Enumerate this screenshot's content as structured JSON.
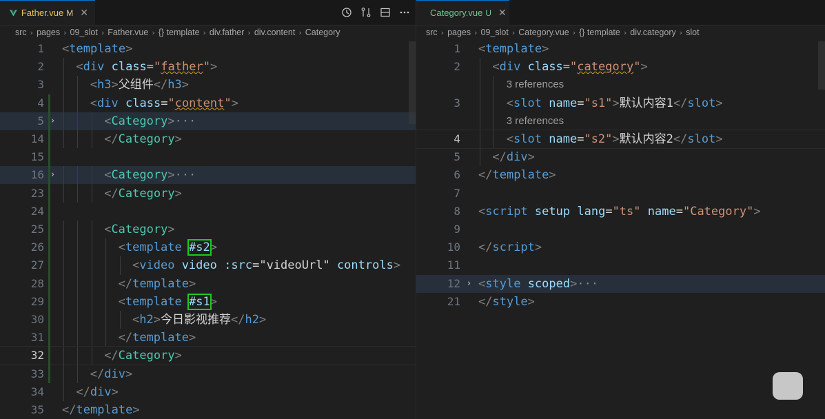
{
  "left": {
    "tab": {
      "name": "Father.vue",
      "status": "M",
      "close": "✕"
    },
    "breadcrumb": [
      "src",
      "pages",
      "09_slot",
      "Father.vue",
      "{} template",
      "div.father",
      "div.content",
      "Category"
    ],
    "lines": [
      {
        "n": "1",
        "parts": [
          [
            "brk",
            "<"
          ],
          [
            "tag",
            "template"
          ],
          [
            "brk",
            ">"
          ]
        ],
        "indent": 0
      },
      {
        "n": "2",
        "parts": [
          [
            "brk",
            "<"
          ],
          [
            "tag",
            "div"
          ],
          [
            "txt",
            " "
          ],
          [
            "attr",
            "class"
          ],
          [
            "txt",
            "="
          ],
          [
            "str",
            "\""
          ],
          [
            "str squig",
            "father"
          ],
          [
            "str",
            "\""
          ],
          [
            "brk",
            ">"
          ]
        ],
        "indent": 1
      },
      {
        "n": "3",
        "parts": [
          [
            "brk",
            "<"
          ],
          [
            "tag",
            "h3"
          ],
          [
            "brk",
            ">"
          ],
          [
            "txt",
            "父组件"
          ],
          [
            "brk",
            "</"
          ],
          [
            "tag",
            "h3"
          ],
          [
            "brk",
            ">"
          ]
        ],
        "indent": 2
      },
      {
        "n": "4",
        "parts": [
          [
            "brk",
            "<"
          ],
          [
            "tag",
            "div"
          ],
          [
            "txt",
            " "
          ],
          [
            "attr",
            "class"
          ],
          [
            "txt",
            "="
          ],
          [
            "str",
            "\""
          ],
          [
            "str squig",
            "content"
          ],
          [
            "str",
            "\""
          ],
          [
            "brk",
            ">"
          ]
        ],
        "indent": 2
      },
      {
        "n": "5",
        "parts": [
          [
            "brk",
            "<"
          ],
          [
            "comp",
            "Category"
          ],
          [
            "brk",
            ">"
          ],
          [
            "dim",
            "···"
          ]
        ],
        "indent": 3,
        "fold": true,
        "hl": true
      },
      {
        "n": "14",
        "parts": [
          [
            "brk",
            "</"
          ],
          [
            "comp",
            "Category"
          ],
          [
            "brk",
            ">"
          ]
        ],
        "indent": 3
      },
      {
        "n": "15",
        "parts": [],
        "indent": 0
      },
      {
        "n": "16",
        "parts": [
          [
            "brk",
            "<"
          ],
          [
            "comp",
            "Category"
          ],
          [
            "brk",
            ">"
          ],
          [
            "dim",
            "···"
          ]
        ],
        "indent": 3,
        "fold": true,
        "hl": true
      },
      {
        "n": "23",
        "parts": [
          [
            "brk",
            "</"
          ],
          [
            "comp",
            "Category"
          ],
          [
            "brk",
            ">"
          ]
        ],
        "indent": 3
      },
      {
        "n": "24",
        "parts": [],
        "indent": 0
      },
      {
        "n": "25",
        "parts": [
          [
            "brk",
            "<"
          ],
          [
            "comp",
            "Category"
          ],
          [
            "brk",
            ">"
          ]
        ],
        "indent": 3
      },
      {
        "n": "26",
        "parts": [
          [
            "brk",
            "<"
          ],
          [
            "tag",
            "template"
          ],
          [
            "txt",
            " "
          ],
          [
            "attr boxed",
            "#s2"
          ],
          [
            "brk",
            ">"
          ]
        ],
        "indent": 4
      },
      {
        "n": "27",
        "parts": [
          [
            "brk",
            "<"
          ],
          [
            "tag",
            "video"
          ],
          [
            "txt",
            " "
          ],
          [
            "attr",
            "video"
          ],
          [
            "txt",
            " "
          ],
          [
            "attr",
            ":src"
          ],
          [
            "txt",
            "="
          ],
          [
            "txt",
            "\"videoUrl\""
          ],
          [
            "txt",
            " "
          ],
          [
            "attr",
            "controls"
          ],
          [
            "brk",
            ">"
          ]
        ],
        "indent": 5
      },
      {
        "n": "28",
        "parts": [
          [
            "brk",
            "</"
          ],
          [
            "tag",
            "template"
          ],
          [
            "brk",
            ">"
          ]
        ],
        "indent": 4
      },
      {
        "n": "29",
        "parts": [
          [
            "brk",
            "<"
          ],
          [
            "tag",
            "template"
          ],
          [
            "txt",
            " "
          ],
          [
            "attr boxed",
            "#s1"
          ],
          [
            "brk",
            ">"
          ]
        ],
        "indent": 4
      },
      {
        "n": "30",
        "parts": [
          [
            "brk",
            "<"
          ],
          [
            "tag",
            "h2"
          ],
          [
            "brk",
            ">"
          ],
          [
            "txt",
            "今日影视推荐"
          ],
          [
            "brk",
            "</"
          ],
          [
            "tag",
            "h2"
          ],
          [
            "brk",
            ">"
          ]
        ],
        "indent": 5
      },
      {
        "n": "31",
        "parts": [
          [
            "brk",
            "</"
          ],
          [
            "tag",
            "template"
          ],
          [
            "brk",
            ">"
          ]
        ],
        "indent": 4
      },
      {
        "n": "32",
        "parts": [
          [
            "brk",
            "</"
          ],
          [
            "comp",
            "Category"
          ],
          [
            "brk",
            ">"
          ]
        ],
        "indent": 3,
        "active": true
      },
      {
        "n": "33",
        "parts": [
          [
            "brk",
            "</"
          ],
          [
            "tag",
            "div"
          ],
          [
            "brk",
            ">"
          ]
        ],
        "indent": 2
      },
      {
        "n": "34",
        "parts": [
          [
            "brk",
            "</"
          ],
          [
            "tag",
            "div"
          ],
          [
            "brk",
            ">"
          ]
        ],
        "indent": 1
      },
      {
        "n": "35",
        "parts": [
          [
            "brk",
            "</"
          ],
          [
            "tag",
            "template"
          ],
          [
            "brk",
            ">"
          ]
        ],
        "indent": 0
      }
    ]
  },
  "right": {
    "tab": {
      "name": "Category.vue",
      "status": "U",
      "close": "✕"
    },
    "breadcrumb": [
      "src",
      "pages",
      "09_slot",
      "Category.vue",
      "{} template",
      "div.category",
      "slot"
    ],
    "lines": [
      {
        "n": "1",
        "parts": [
          [
            "brk",
            "<"
          ],
          [
            "tag",
            "template"
          ],
          [
            "brk",
            ">"
          ]
        ],
        "indent": 0
      },
      {
        "n": "2",
        "parts": [
          [
            "brk",
            "<"
          ],
          [
            "tag",
            "div"
          ],
          [
            "txt",
            " "
          ],
          [
            "attr",
            "class"
          ],
          [
            "txt",
            "="
          ],
          [
            "str",
            "\""
          ],
          [
            "str squig",
            "category"
          ],
          [
            "str",
            "\""
          ],
          [
            "brk",
            ">"
          ]
        ],
        "indent": 1
      },
      {
        "ref": "3 references",
        "indent": 2
      },
      {
        "n": "3",
        "parts": [
          [
            "brk",
            "<"
          ],
          [
            "tag",
            "slot"
          ],
          [
            "txt",
            " "
          ],
          [
            "attr",
            "name"
          ],
          [
            "txt",
            "="
          ],
          [
            "str",
            "\"s1\""
          ],
          [
            "brk",
            ">"
          ],
          [
            "txt",
            "默认内容1"
          ],
          [
            "brk",
            "</"
          ],
          [
            "tag",
            "slot"
          ],
          [
            "brk",
            ">"
          ]
        ],
        "indent": 2
      },
      {
        "ref": "3 references",
        "indent": 2
      },
      {
        "n": "4",
        "parts": [
          [
            "brk",
            "<"
          ],
          [
            "tag",
            "slot"
          ],
          [
            "txt",
            " "
          ],
          [
            "attr",
            "name"
          ],
          [
            "txt",
            "="
          ],
          [
            "str",
            "\"s2\""
          ],
          [
            "brk",
            ">"
          ],
          [
            "txt",
            "默认内容2"
          ],
          [
            "brk",
            "</"
          ],
          [
            "tag",
            "slot"
          ],
          [
            "brk",
            ">"
          ]
        ],
        "indent": 2,
        "active": true
      },
      {
        "n": "5",
        "parts": [
          [
            "brk",
            "</"
          ],
          [
            "tag",
            "div"
          ],
          [
            "brk",
            ">"
          ]
        ],
        "indent": 1
      },
      {
        "n": "6",
        "parts": [
          [
            "brk",
            "</"
          ],
          [
            "tag",
            "template"
          ],
          [
            "brk",
            ">"
          ]
        ],
        "indent": 0
      },
      {
        "n": "7",
        "parts": [],
        "indent": 0
      },
      {
        "n": "8",
        "parts": [
          [
            "brk",
            "<"
          ],
          [
            "tag",
            "script"
          ],
          [
            "txt",
            " "
          ],
          [
            "attr",
            "setup"
          ],
          [
            "txt",
            " "
          ],
          [
            "attr",
            "lang"
          ],
          [
            "txt",
            "="
          ],
          [
            "str",
            "\"ts\""
          ],
          [
            "txt",
            " "
          ],
          [
            "attr",
            "name"
          ],
          [
            "txt",
            "="
          ],
          [
            "str",
            "\"Category\""
          ],
          [
            "brk",
            ">"
          ]
        ],
        "indent": 0
      },
      {
        "n": "9",
        "parts": [],
        "indent": 0
      },
      {
        "n": "10",
        "parts": [
          [
            "brk",
            "</"
          ],
          [
            "tag",
            "script"
          ],
          [
            "brk",
            ">"
          ]
        ],
        "indent": 0
      },
      {
        "n": "11",
        "parts": [],
        "indent": 0
      },
      {
        "n": "12",
        "parts": [
          [
            "brk",
            "<"
          ],
          [
            "tag",
            "style"
          ],
          [
            "txt",
            " "
          ],
          [
            "attr",
            "scoped"
          ],
          [
            "brk",
            ">"
          ],
          [
            "dim",
            "···"
          ]
        ],
        "indent": 0,
        "fold": true,
        "hl": true
      },
      {
        "n": "21",
        "parts": [
          [
            "brk",
            "</"
          ],
          [
            "tag",
            "style"
          ],
          [
            "brk",
            ">"
          ]
        ],
        "indent": 0
      }
    ]
  },
  "icons": [
    "vue-icon",
    "timeline-icon",
    "compare-changes-icon",
    "split-editor-icon",
    "more-actions-icon"
  ],
  "colors": {
    "tag": "#569cd6",
    "attr": "#9cdcfe",
    "string": "#ce9178",
    "component": "#4ec9b0",
    "highlight_box": "#1ec91e",
    "modified": "#e2c08d"
  }
}
